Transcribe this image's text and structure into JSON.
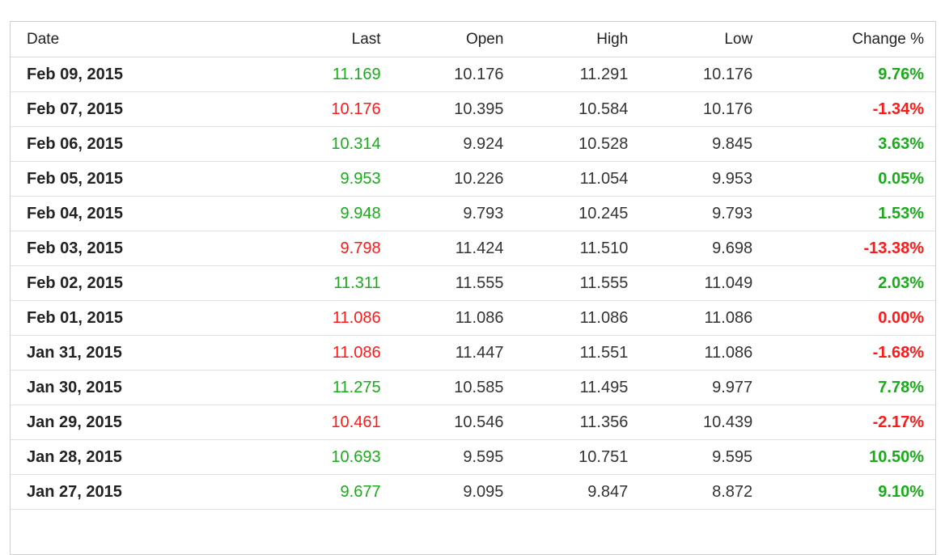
{
  "colors": {
    "up": "#1aab1a",
    "down": "#ff1a1a"
  },
  "table": {
    "headers": [
      "Date",
      "Last",
      "Open",
      "High",
      "Low",
      "Change %"
    ],
    "rows": [
      {
        "date": "Feb 09, 2015",
        "last": "11.169",
        "open": "10.176",
        "high": "11.291",
        "low": "10.176",
        "change": "9.76%",
        "dir": "up"
      },
      {
        "date": "Feb 07, 2015",
        "last": "10.176",
        "open": "10.395",
        "high": "10.584",
        "low": "10.176",
        "change": "-1.34%",
        "dir": "down"
      },
      {
        "date": "Feb 06, 2015",
        "last": "10.314",
        "open": "9.924",
        "high": "10.528",
        "low": "9.845",
        "change": "3.63%",
        "dir": "up"
      },
      {
        "date": "Feb 05, 2015",
        "last": "9.953",
        "open": "10.226",
        "high": "11.054",
        "low": "9.953",
        "change": "0.05%",
        "dir": "up"
      },
      {
        "date": "Feb 04, 2015",
        "last": "9.948",
        "open": "9.793",
        "high": "10.245",
        "low": "9.793",
        "change": "1.53%",
        "dir": "up"
      },
      {
        "date": "Feb 03, 2015",
        "last": "9.798",
        "open": "11.424",
        "high": "11.510",
        "low": "9.698",
        "change": "-13.38%",
        "dir": "down"
      },
      {
        "date": "Feb 02, 2015",
        "last": "11.311",
        "open": "11.555",
        "high": "11.555",
        "low": "11.049",
        "change": "2.03%",
        "dir": "up"
      },
      {
        "date": "Feb 01, 2015",
        "last": "11.086",
        "open": "11.086",
        "high": "11.086",
        "low": "11.086",
        "change": "0.00%",
        "dir": "down"
      },
      {
        "date": "Jan 31, 2015",
        "last": "11.086",
        "open": "11.447",
        "high": "11.551",
        "low": "11.086",
        "change": "-1.68%",
        "dir": "down"
      },
      {
        "date": "Jan 30, 2015",
        "last": "11.275",
        "open": "10.585",
        "high": "11.495",
        "low": "9.977",
        "change": "7.78%",
        "dir": "up"
      },
      {
        "date": "Jan 29, 2015",
        "last": "10.461",
        "open": "10.546",
        "high": "11.356",
        "low": "10.439",
        "change": "-2.17%",
        "dir": "down"
      },
      {
        "date": "Jan 28, 2015",
        "last": "10.693",
        "open": "9.595",
        "high": "10.751",
        "low": "9.595",
        "change": "10.50%",
        "dir": "up"
      },
      {
        "date": "Jan 27, 2015",
        "last": "9.677",
        "open": "9.095",
        "high": "9.847",
        "low": "8.872",
        "change": "9.10%",
        "dir": "up"
      }
    ]
  }
}
